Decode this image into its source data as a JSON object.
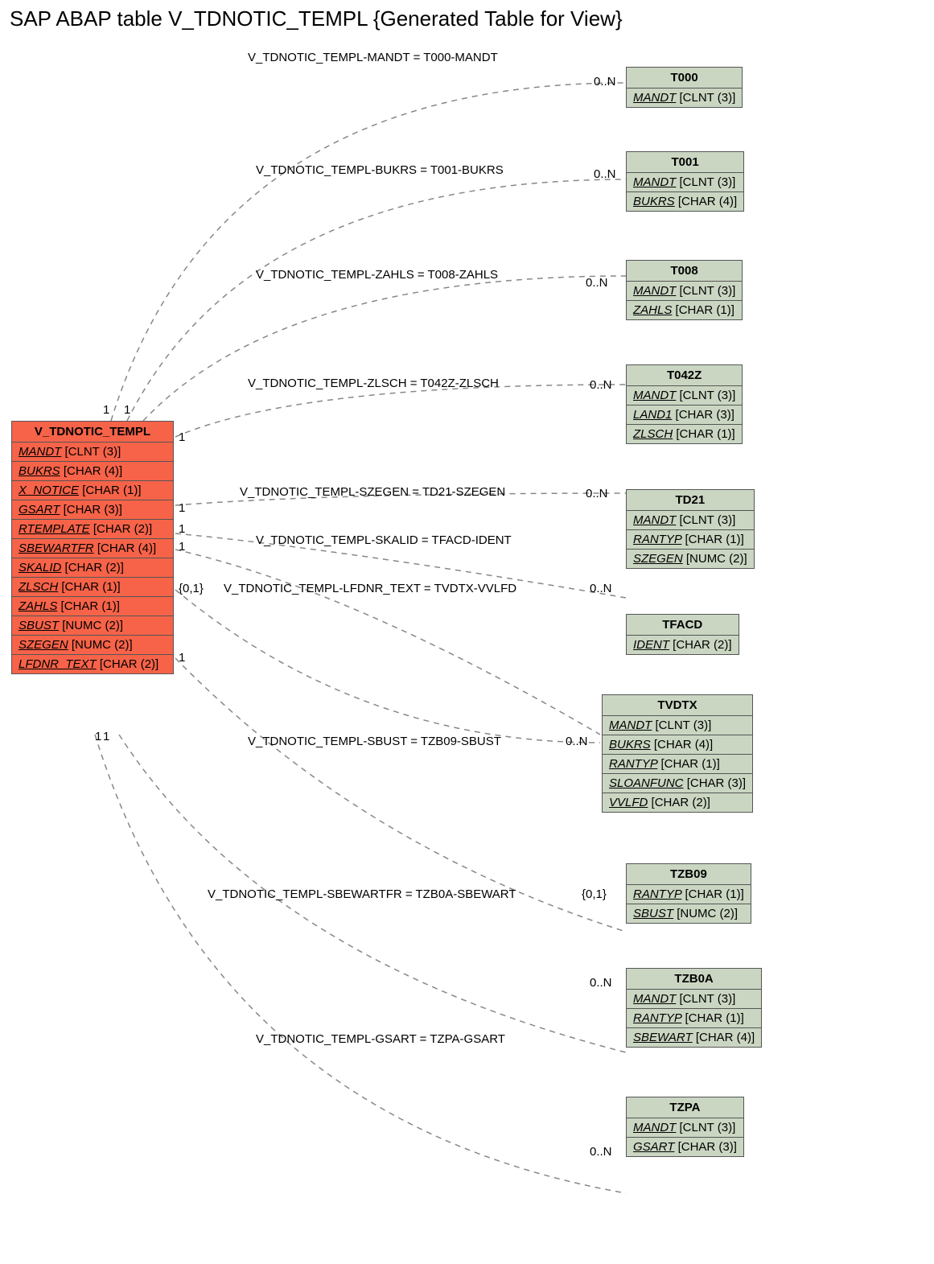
{
  "title": "SAP ABAP table V_TDNOTIC_TEMPL {Generated Table for View}",
  "main_entity": {
    "name": "V_TDNOTIC_TEMPL",
    "fields": [
      {
        "name": "MANDT",
        "type": "[CLNT (3)]"
      },
      {
        "name": "BUKRS",
        "type": "[CHAR (4)]"
      },
      {
        "name": "X_NOTICE",
        "type": "[CHAR (1)]"
      },
      {
        "name": "GSART",
        "type": "[CHAR (3)]"
      },
      {
        "name": "RTEMPLATE",
        "type": "[CHAR (2)]"
      },
      {
        "name": "SBEWARTFR",
        "type": "[CHAR (4)]"
      },
      {
        "name": "SKALID",
        "type": "[CHAR (2)]"
      },
      {
        "name": "ZLSCH",
        "type": "[CHAR (1)]"
      },
      {
        "name": "ZAHLS",
        "type": "[CHAR (1)]"
      },
      {
        "name": "SBUST",
        "type": "[NUMC (2)]"
      },
      {
        "name": "SZEGEN",
        "type": "[NUMC (2)]"
      },
      {
        "name": "LFDNR_TEXT",
        "type": "[CHAR (2)]"
      }
    ]
  },
  "targets": [
    {
      "name": "T000",
      "fields": [
        {
          "name": "MANDT",
          "type": "[CLNT (3)]"
        }
      ]
    },
    {
      "name": "T001",
      "fields": [
        {
          "name": "MANDT",
          "type": "[CLNT (3)]"
        },
        {
          "name": "BUKRS",
          "type": "[CHAR (4)]"
        }
      ]
    },
    {
      "name": "T008",
      "fields": [
        {
          "name": "MANDT",
          "type": "[CLNT (3)]"
        },
        {
          "name": "ZAHLS",
          "type": "[CHAR (1)]"
        }
      ]
    },
    {
      "name": "T042Z",
      "fields": [
        {
          "name": "MANDT",
          "type": "[CLNT (3)]"
        },
        {
          "name": "LAND1",
          "type": "[CHAR (3)]"
        },
        {
          "name": "ZLSCH",
          "type": "[CHAR (1)]"
        }
      ]
    },
    {
      "name": "TD21",
      "fields": [
        {
          "name": "MANDT",
          "type": "[CLNT (3)]"
        },
        {
          "name": "RANTYP",
          "type": "[CHAR (1)]"
        },
        {
          "name": "SZEGEN",
          "type": "[NUMC (2)]"
        }
      ]
    },
    {
      "name": "TFACD",
      "fields": [
        {
          "name": "IDENT",
          "type": "[CHAR (2)]"
        }
      ]
    },
    {
      "name": "TVDTX",
      "fields": [
        {
          "name": "MANDT",
          "type": "[CLNT (3)]"
        },
        {
          "name": "BUKRS",
          "type": "[CHAR (4)]"
        },
        {
          "name": "RANTYP",
          "type": "[CHAR (1)]"
        },
        {
          "name": "SLOANFUNC",
          "type": "[CHAR (3)]"
        },
        {
          "name": "VVLFD",
          "type": "[CHAR (2)]"
        }
      ]
    },
    {
      "name": "TZB09",
      "fields": [
        {
          "name": "RANTYP",
          "type": "[CHAR (1)]"
        },
        {
          "name": "SBUST",
          "type": "[NUMC (2)]"
        }
      ]
    },
    {
      "name": "TZB0A",
      "fields": [
        {
          "name": "MANDT",
          "type": "[CLNT (3)]"
        },
        {
          "name": "RANTYP",
          "type": "[CHAR (1)]"
        },
        {
          "name": "SBEWART",
          "type": "[CHAR (4)]"
        }
      ]
    },
    {
      "name": "TZPA",
      "fields": [
        {
          "name": "MANDT",
          "type": "[CLNT (3)]"
        },
        {
          "name": "GSART",
          "type": "[CHAR (3)]"
        }
      ]
    }
  ],
  "relations": [
    {
      "label": "V_TDNOTIC_TEMPL-MANDT = T000-MANDT",
      "card_right": "0..N"
    },
    {
      "label": "V_TDNOTIC_TEMPL-BUKRS = T001-BUKRS",
      "card_right": "0..N"
    },
    {
      "label": "V_TDNOTIC_TEMPL-ZAHLS = T008-ZAHLS",
      "card_right": "0..N"
    },
    {
      "label": "V_TDNOTIC_TEMPL-ZLSCH = T042Z-ZLSCH",
      "card_right": "0..N"
    },
    {
      "label": "V_TDNOTIC_TEMPL-SZEGEN = TD21-SZEGEN",
      "card_right": "0..N"
    },
    {
      "label": "V_TDNOTIC_TEMPL-SKALID = TFACD-IDENT",
      "card_right": "0..N"
    },
    {
      "label": "V_TDNOTIC_TEMPL-LFDNR_TEXT = TVDTX-VVLFD",
      "card_right": "0..N"
    },
    {
      "label": "V_TDNOTIC_TEMPL-SBUST = TZB09-SBUST",
      "card_right": "{0,1}"
    },
    {
      "label": "V_TDNOTIC_TEMPL-SBEWARTFR = TZB0A-SBEWART",
      "card_right": "0..N"
    },
    {
      "label": "V_TDNOTIC_TEMPL-GSART = TZPA-GSART",
      "card_right": "0..N"
    }
  ],
  "left_cards": [
    "1",
    "1",
    "1",
    "1",
    "1",
    "1",
    "{0,1}",
    "1",
    "1",
    "1"
  ],
  "left_card_first_pair_note": "two '1' labels near top of main entity for first two edges differ in x slightly"
}
